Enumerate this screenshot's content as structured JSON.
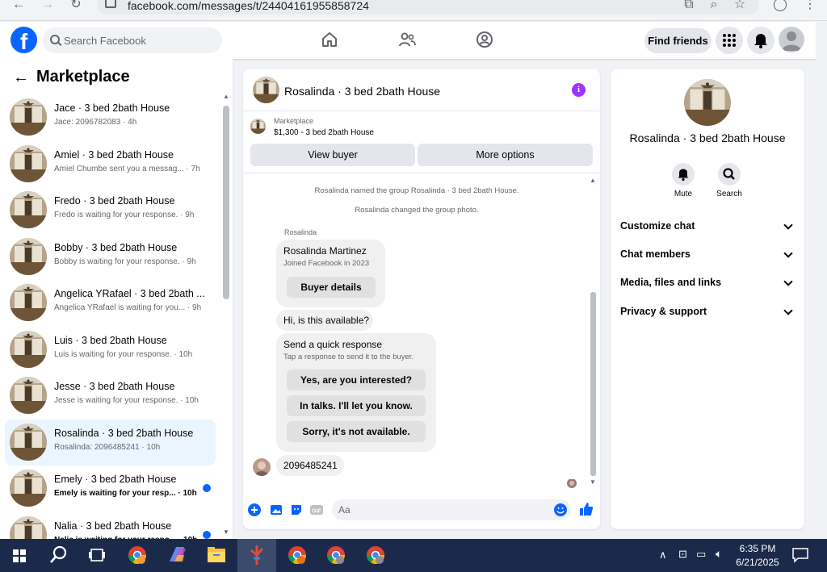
{
  "browser": {
    "url": "facebook.com/messages/t/24404161955858724"
  },
  "header": {
    "logo": "f",
    "search_placeholder": "Search Facebook",
    "find_friends": "Find friends"
  },
  "sidebar": {
    "title": "Marketplace",
    "conversations": [
      {
        "name": "Jace · 3 bed 2bath House",
        "preview": "Jace: 2096782083 · 4h",
        "active": false,
        "unread": false
      },
      {
        "name": "Amiel · 3 bed 2bath House",
        "preview": "Amiel Chumbe sent you a messag... · 7h",
        "active": false,
        "unread": false
      },
      {
        "name": "Fredo · 3 bed 2bath House",
        "preview": "Fredo is waiting for your response. · 9h",
        "active": false,
        "unread": false
      },
      {
        "name": "Bobby · 3 bed 2bath House",
        "preview": "Bobby is waiting for your response. · 9h",
        "active": false,
        "unread": false
      },
      {
        "name": "Angelica YRafael · 3 bed 2bath ...",
        "preview": "Angelica YRafael is waiting for you... · 9h",
        "active": false,
        "unread": false
      },
      {
        "name": "Luis · 3 bed 2bath House",
        "preview": "Luis is waiting for your response. · 10h",
        "active": false,
        "unread": false
      },
      {
        "name": "Jesse · 3 bed 2bath House",
        "preview": "Jesse is waiting for your response. · 10h",
        "active": false,
        "unread": false
      },
      {
        "name": "Rosalinda · 3 bed 2bath House",
        "preview": "Rosalinda: 2096485241 · 10h",
        "active": true,
        "unread": false
      },
      {
        "name": "Emely · 3 bed 2bath House",
        "preview": "Emely is waiting for your resp... · 10h",
        "active": false,
        "unread": true
      },
      {
        "name": "Nalia · 3 bed 2bath House",
        "preview": "Nalia is waiting for your respo... · 10h",
        "active": false,
        "unread": true
      }
    ]
  },
  "chat": {
    "title": "Rosalinda · 3 bed 2bath House",
    "listing_label": "Marketplace",
    "listing_price": "$1,300 - 3 bed 2bath House",
    "view_buyer": "View buyer",
    "more_options": "More options",
    "system_messages": [
      "Rosalinda named the group Rosalinda · 3 bed 2bath House.",
      "Rosalinda changed the group photo."
    ],
    "sender": "Rosalinda",
    "profile_card": {
      "name": "Rosalinda Martinez",
      "joined": "Joined Facebook in 2023",
      "button": "Buyer details"
    },
    "message_1": "Hi, is this available?",
    "quick_response": {
      "title": "Send a quick response",
      "subtitle": "Tap a response to send it to the buyer.",
      "options": [
        "Yes, are you interested?",
        "In talks. I'll let you know.",
        "Sorry, it's not available."
      ]
    },
    "message_2": "2096485241",
    "composer_placeholder": "Aa"
  },
  "details": {
    "title": "Rosalinda · 3 bed 2bath House",
    "actions": [
      {
        "label": "Mute",
        "icon": "bell-icon"
      },
      {
        "label": "Search",
        "icon": "search-icon"
      }
    ],
    "sections": [
      "Customize chat",
      "Chat members",
      "Media, files and links",
      "Privacy & support"
    ]
  },
  "taskbar": {
    "time": "6:35 PM",
    "date": "6/21/2025"
  },
  "colors": {
    "brand": "#0866ff",
    "active_conv": "#ebf5ff",
    "info": "#a033ff",
    "taskbar": "#1b2a4a"
  }
}
